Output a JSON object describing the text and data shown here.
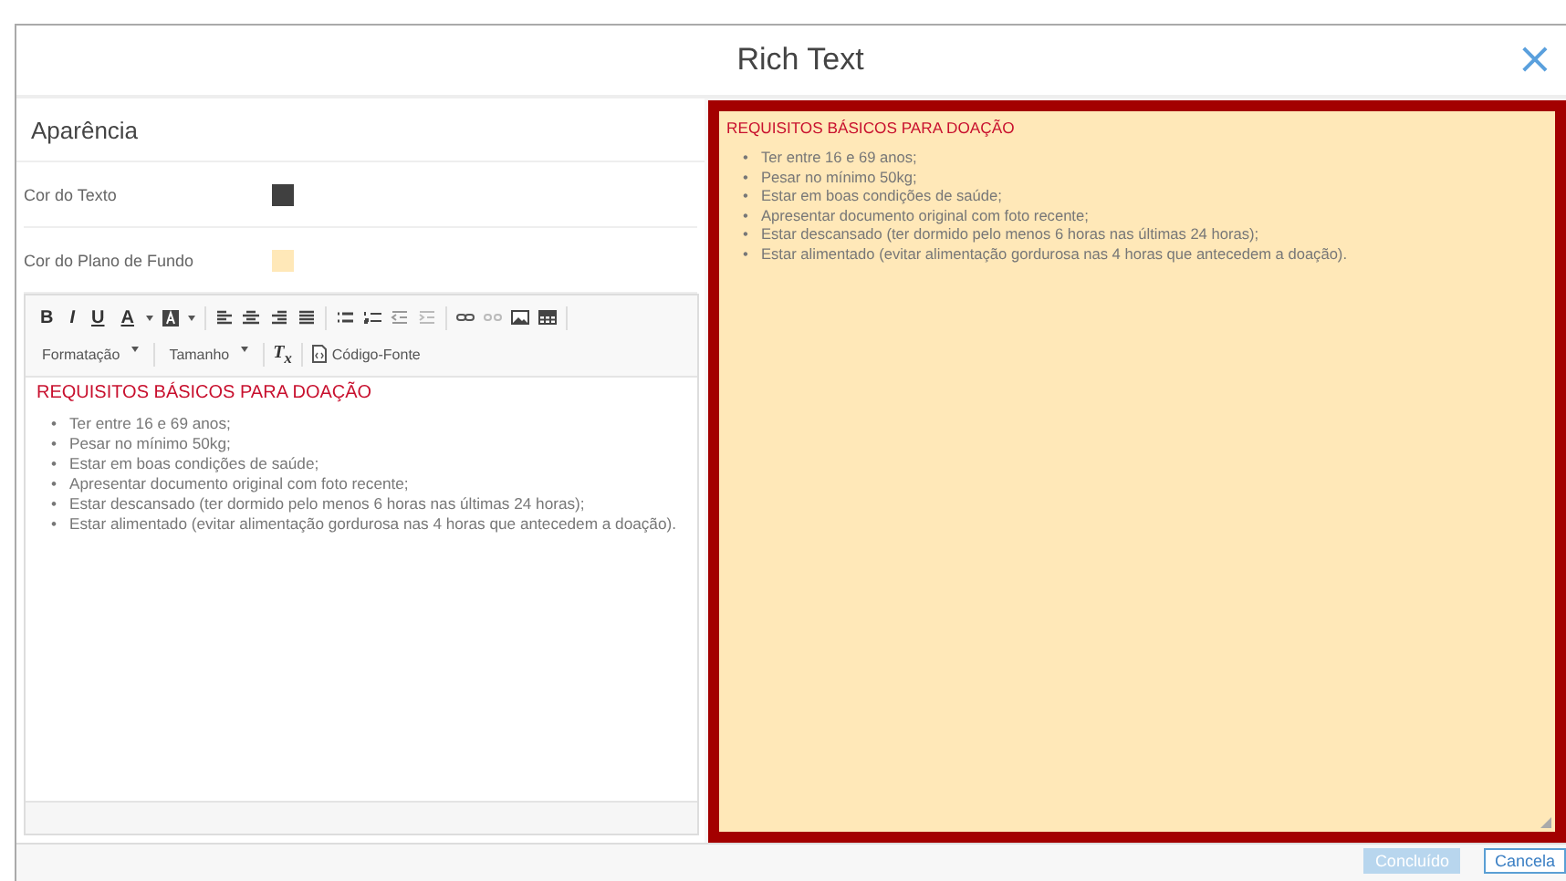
{
  "window": {
    "title": "Rich Text",
    "close": "×"
  },
  "settings": {
    "title": "Aparência",
    "rows": [
      {
        "label": "Cor do Texto",
        "color": "#404040"
      },
      {
        "label": "Cor do Plano de Fundo",
        "color": "#ffe8b8"
      }
    ]
  },
  "toolbar": {
    "letters": [
      "B",
      "I",
      "U",
      "A"
    ],
    "dropdowns": [
      "Formatação",
      "Tamanho"
    ],
    "clear_format": "T$_{x}$",
    "source": "Código-Fonte"
  },
  "editor": {
    "bullet": "•",
    "heading": "REQUISITOS BÁSICOS PARA DOAÇÃO",
    "items": [
      "Ter entre 16 e 69 anos;",
      "Pesar no mínimo 50kg;",
      "Estar em boas condições de saúde;",
      "Apresentar documento original com foto recente;",
      "Estar descansado (ter dormido pelo menos 6 horas nas últimas 24 horas);",
      "Estar alimentado (evitar alimentação gordurosa nas 4 horas que antecedem a doação)."
    ]
  },
  "preview": {
    "bullet": "•",
    "heading": "REQUISITOS BÁSICOS PARA DOAÇÃO",
    "items": [
      "Ter entre 16 e 69 anos;",
      "Pesar no mínimo 50kg;",
      "Estar em boas condições de saúde;",
      "Apresentar documento original com foto recente;",
      "Estar descansado (ter dormido pelo menos 6 horas nas últimas 24 horas);",
      "Estar alimentado (evitar alimentação gordurosa nas 4 horas que antecedem a doação)."
    ]
  },
  "buttons": [
    {
      "label": "Concluído",
      "disabled": true
    },
    {
      "label": "Cancela",
      "disabled": false
    }
  ]
}
